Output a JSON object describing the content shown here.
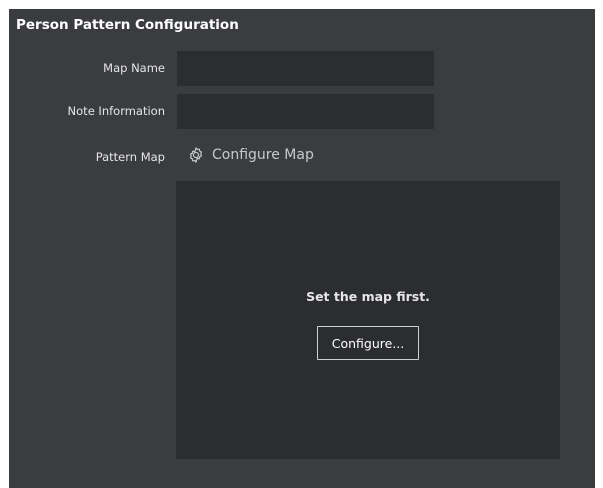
{
  "panel": {
    "title": "Person Pattern Configuration"
  },
  "form": {
    "map_name_label": "Map Name",
    "map_name_value": "",
    "note_label": "Note Information",
    "note_value": "",
    "pattern_map_label": "Pattern Map",
    "configure_map_link": "Configure Map",
    "configure_map_icon": "gear-icon"
  },
  "map_area": {
    "message": "Set the map first.",
    "button_label": "Configure..."
  },
  "colors": {
    "panel_bg": "#3a3c40",
    "field_bg": "#2c2d30",
    "text": "#e6e6e6"
  }
}
